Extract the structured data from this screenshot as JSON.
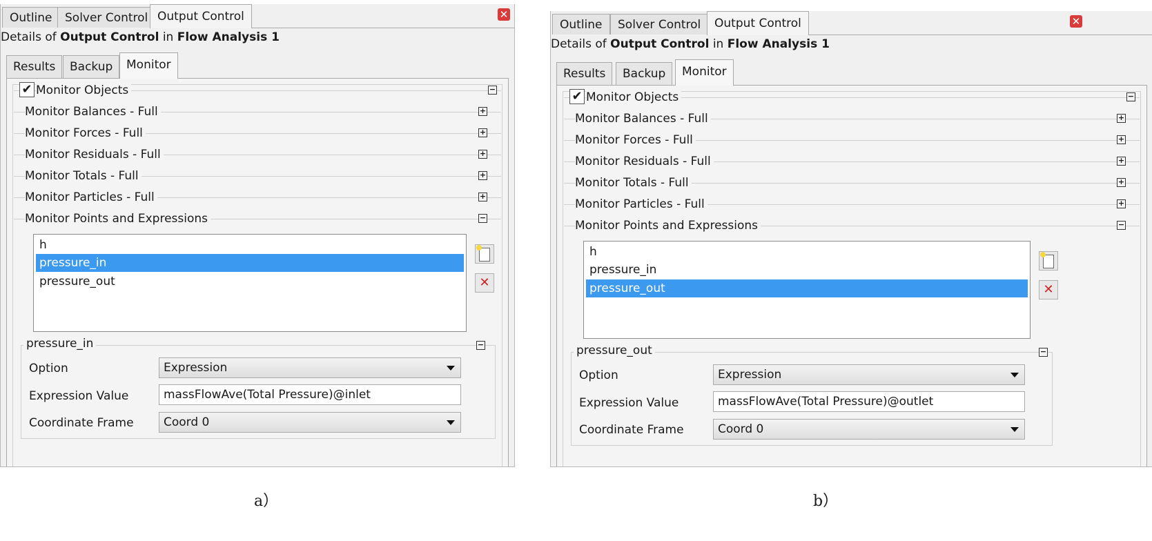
{
  "panels": [
    {
      "tabs": [
        "Outline",
        "Solver Control",
        "Output Control"
      ],
      "active_tab": 2,
      "title": {
        "prefix": "Details of ",
        "object": "Output Control",
        "mid": " in ",
        "context": "Flow Analysis 1"
      },
      "subtabs": [
        "Results",
        "Backup",
        "Monitor"
      ],
      "active_subtab": 2,
      "monitor_objects_label": "Monitor Objects",
      "monitor_objects_checked": true,
      "groups": [
        "Monitor Balances - Full",
        "Monitor Forces - Full",
        "Monitor Residuals - Full",
        "Monitor Totals - Full",
        "Monitor Particles - Full"
      ],
      "points_group_label": "Monitor Points and Expressions",
      "list_items": [
        "h",
        "pressure_in",
        "pressure_out"
      ],
      "selected_index": 1,
      "detail_title": "pressure_in",
      "option_label": "Option",
      "option_value": "Expression",
      "expression_label": "Expression Value",
      "expression_value": "massFlowAve(Total Pressure)@inlet",
      "frame_label": "Coordinate Frame",
      "frame_value": "Coord 0",
      "caption": "a）"
    },
    {
      "tabs": [
        "Outline",
        "Solver Control",
        "Output Control"
      ],
      "active_tab": 2,
      "title": {
        "prefix": "Details of ",
        "object": "Output Control",
        "mid": " in ",
        "context": "Flow Analysis 1"
      },
      "subtabs": [
        "Results",
        "Backup",
        "Monitor"
      ],
      "active_subtab": 2,
      "monitor_objects_label": "Monitor Objects",
      "monitor_objects_checked": true,
      "groups": [
        "Monitor Balances - Full",
        "Monitor Forces - Full",
        "Monitor Residuals - Full",
        "Monitor Totals - Full",
        "Monitor Particles - Full"
      ],
      "points_group_label": "Monitor Points and Expressions",
      "list_items": [
        "h",
        "pressure_in",
        "pressure_out"
      ],
      "selected_index": 2,
      "detail_title": "pressure_out",
      "option_label": "Option",
      "option_value": "Expression",
      "expression_label": "Expression Value",
      "expression_value": "massFlowAve(Total Pressure)@outlet",
      "frame_label": "Coordinate Frame",
      "frame_value": "Coord 0",
      "caption": "b）"
    }
  ],
  "icons": {
    "close": "close-icon",
    "new": "new-item-icon",
    "delete": "delete-icon",
    "expand": "expand-icon",
    "collapse": "collapse-icon",
    "check": "checkmark-icon"
  },
  "colors": {
    "selection": "#3b99f0",
    "close": "#d93a3a",
    "delete": "#cc2222"
  }
}
